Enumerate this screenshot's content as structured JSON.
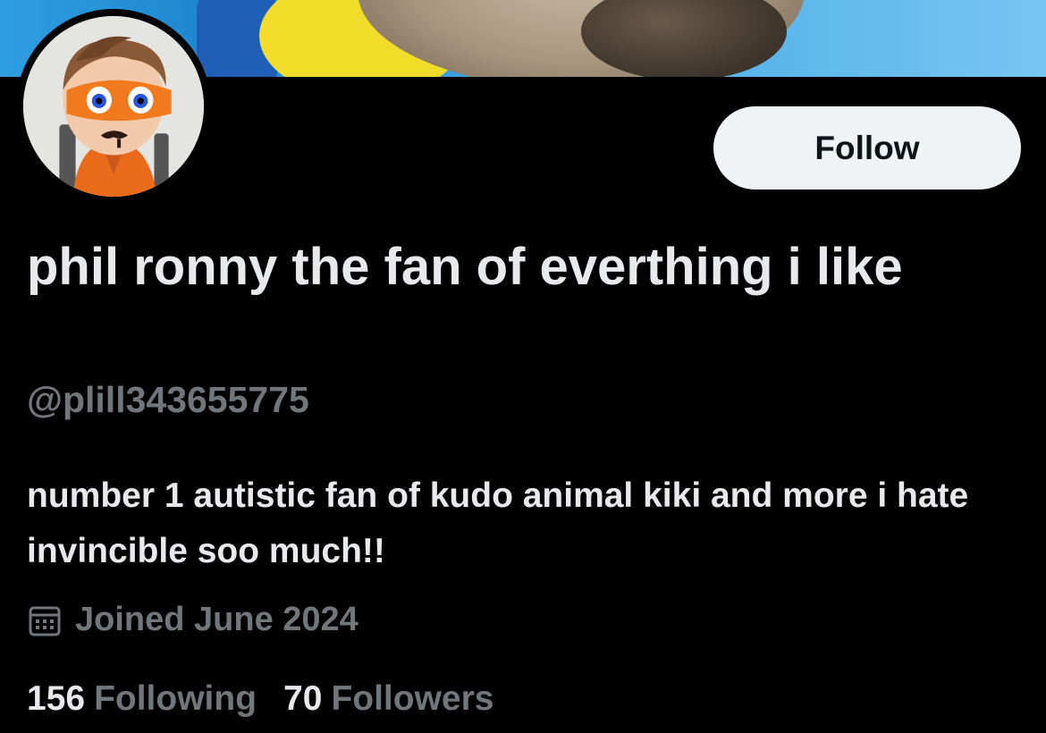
{
  "profile": {
    "display_name": "phil ronny the fan of everthing i like",
    "handle": "@plill343655775",
    "bio": "number 1 autistic fan of kudo animal kiki and more i hate invincible soo much!!",
    "joined": "Joined June 2024",
    "follow_label": "Follow"
  },
  "stats": {
    "following_count": "156",
    "following_label": "Following",
    "followers_count": "70",
    "followers_label": "Followers"
  },
  "icons": {
    "joined": "calendar-icon"
  },
  "colors": {
    "background": "#000000",
    "primary_text": "#e7e9ea",
    "secondary_text": "#71767b",
    "follow_button_bg": "#eff3f4",
    "follow_button_text": "#0f1419"
  }
}
